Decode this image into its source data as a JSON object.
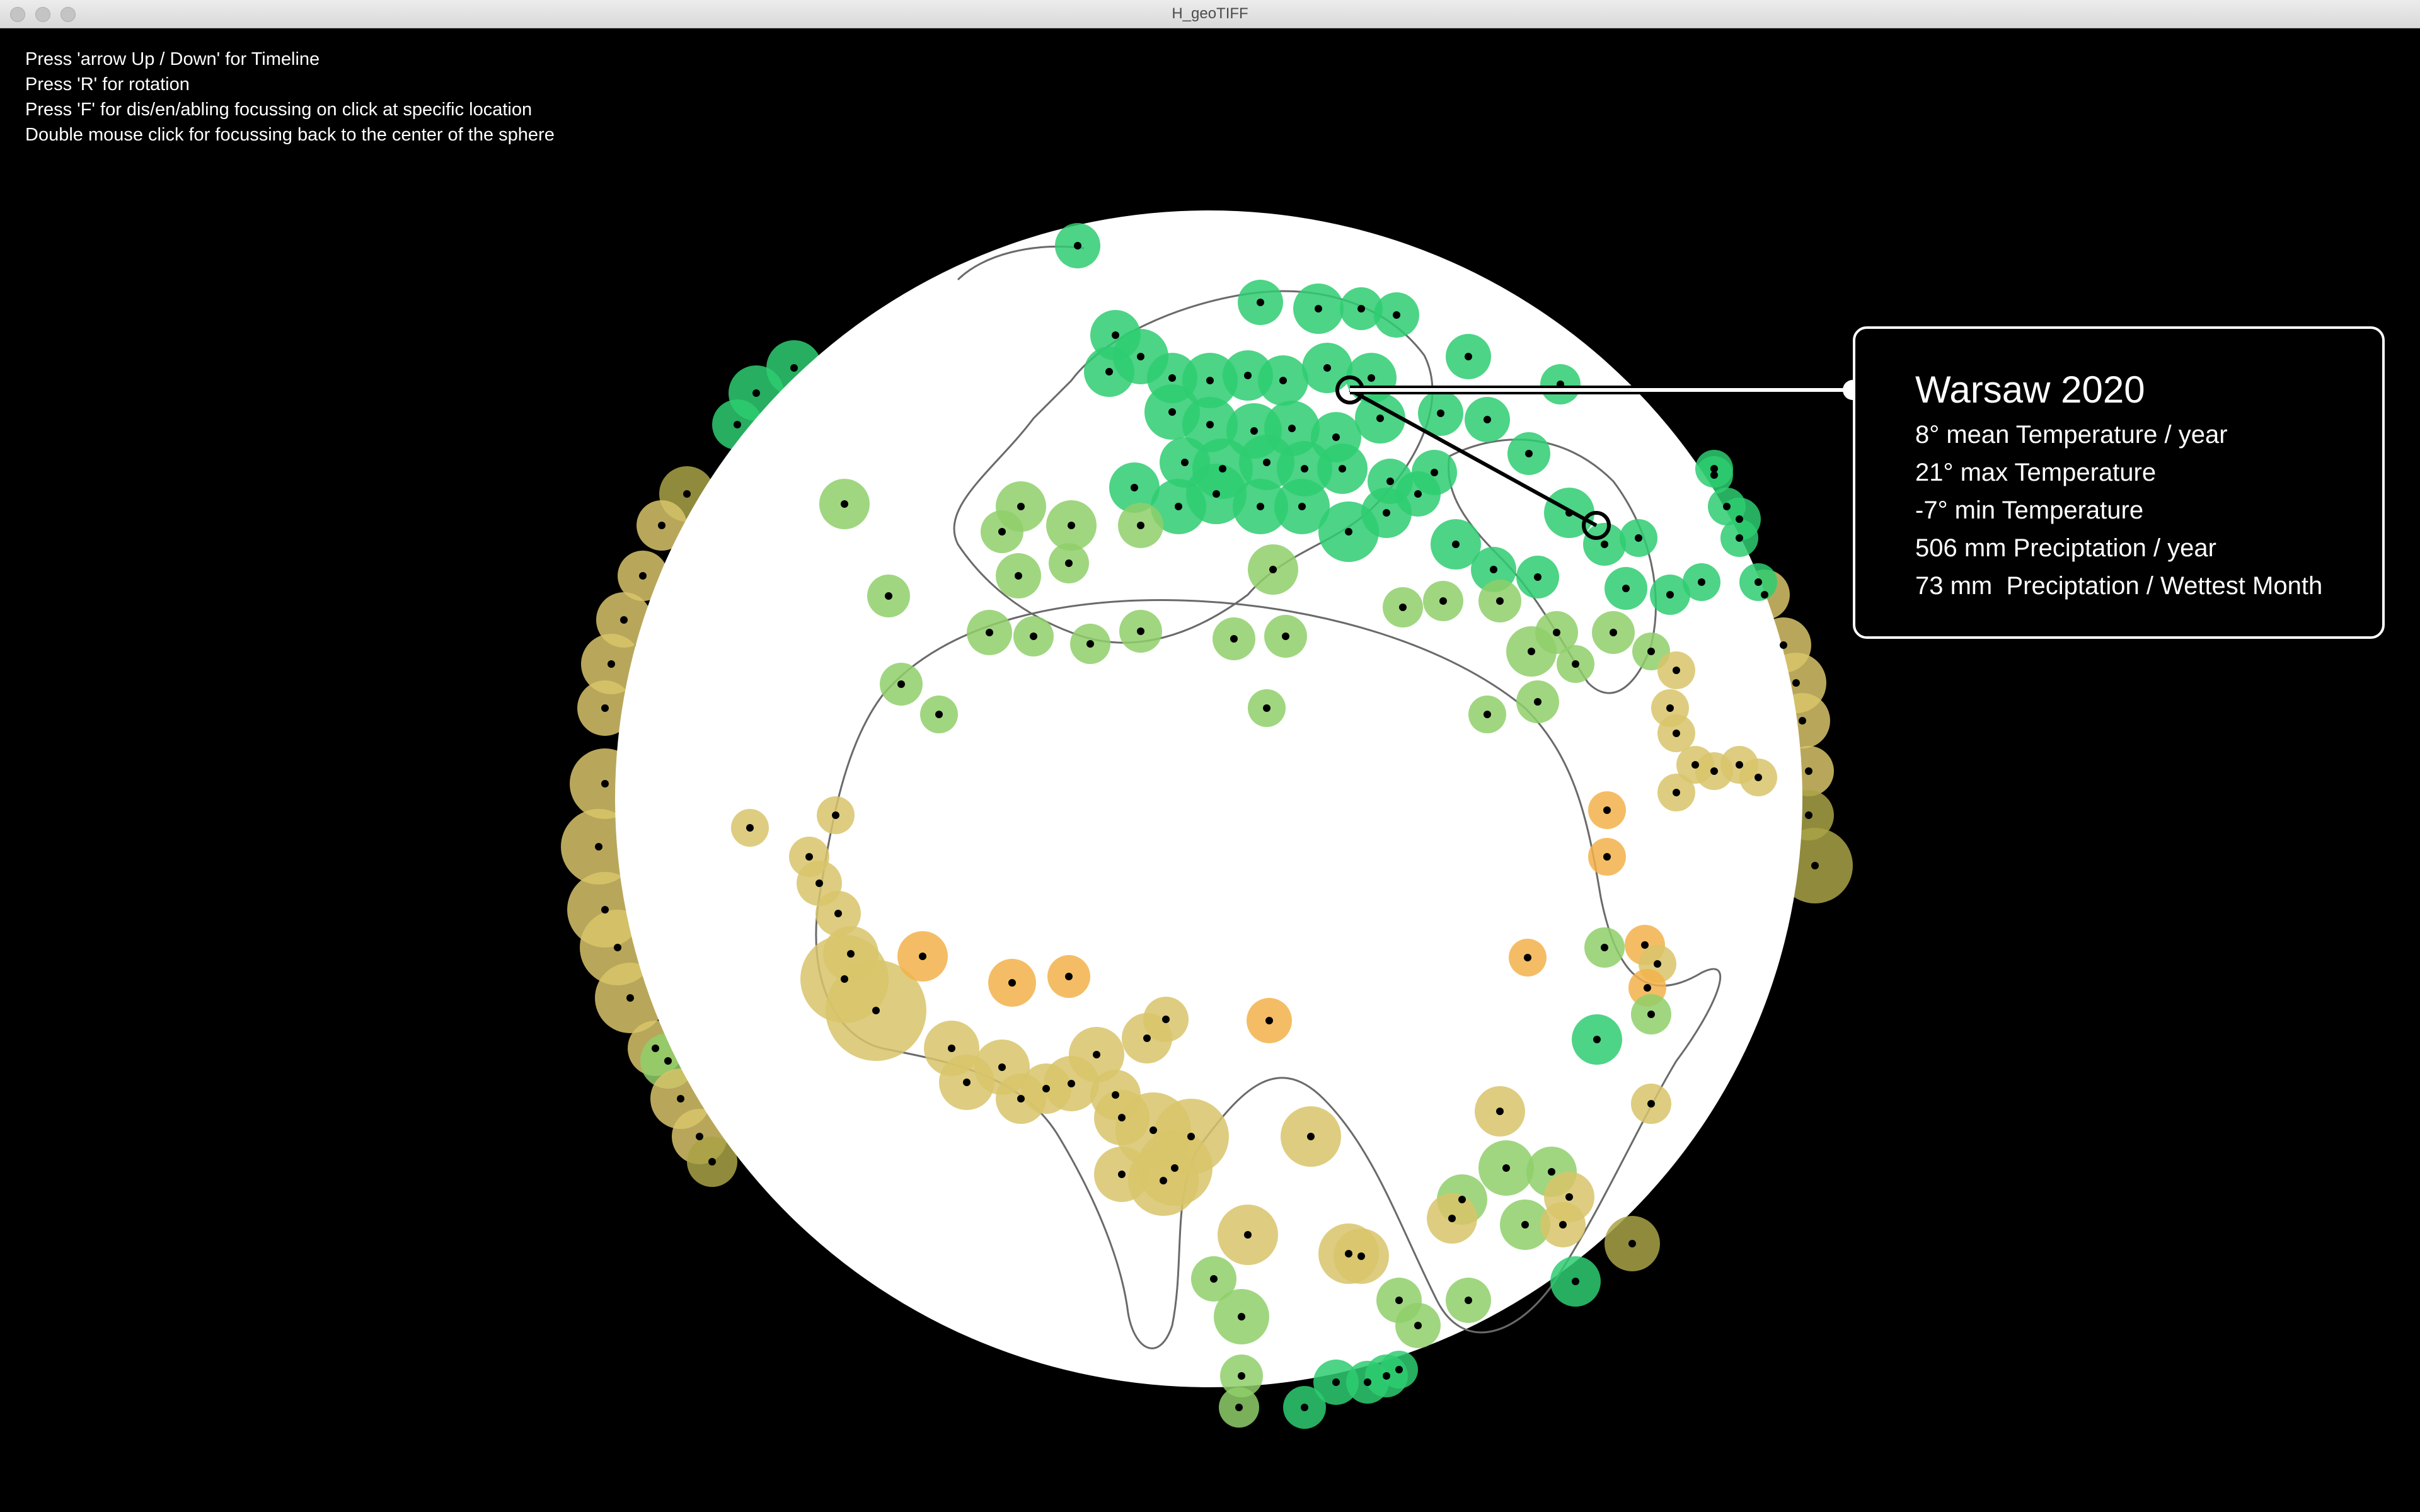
{
  "window": {
    "title": "H_geoTIFF"
  },
  "instructions": [
    "Press 'arrow Up / Down' for Timeline",
    "Press 'R' for rotation",
    "Press 'F' for dis/en/abling focussing on click at specific location",
    "Double mouse click for focussing back to the center of the sphere"
  ],
  "info": {
    "title": "Warsaw 2020",
    "lines": [
      "8° mean Temperature / year",
      "21° max Temperature",
      "-7° min Temperature",
      "506 mm Preciptation / year",
      "73 mm  Preciptation / Wettest Month"
    ]
  },
  "colors": {
    "background": "#000000",
    "globe": "#ffffff",
    "cold_green": "#2ecc71",
    "mild_green": "#8fcf6a",
    "warm_yellow": "#d8c46a",
    "hot_orange": "#f2b24a",
    "olive": "#a9a247"
  }
}
